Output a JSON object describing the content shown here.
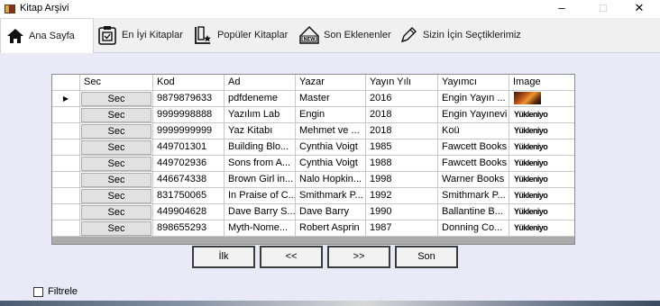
{
  "window": {
    "title": "Kitap Arşivi",
    "minimize": "–",
    "maximize": "□",
    "close": "✕"
  },
  "tabs": [
    {
      "label": "Ana Sayfa",
      "icon": "home-icon"
    },
    {
      "label": "En İyi Kitaplar",
      "icon": "checkbox-book-icon"
    },
    {
      "label": "Popüler Kitaplar",
      "icon": "popular-book-icon"
    },
    {
      "label": "Son Eklenenler",
      "icon": "new-badge-icon"
    },
    {
      "label": "Sizin İçin Seçtiklerimiz",
      "icon": "pen-icon"
    }
  ],
  "grid": {
    "columns": [
      "Sec",
      "Kod",
      "Ad",
      "Yazar",
      "Yayın Yılı",
      "Yayımcı",
      "Image"
    ],
    "rows": [
      {
        "sec": "Sec",
        "kod": "9879879633",
        "ad": "pdfdeneme",
        "yazar": "Master",
        "yil": "2016",
        "yayimci": "Engin Yayın ...",
        "image": "",
        "thumb": true,
        "current": true
      },
      {
        "sec": "Sec",
        "kod": "9999998888",
        "ad": "Yazılım Lab",
        "yazar": "Engin",
        "yil": "2018",
        "yayimci": "Engin Yayınevi",
        "image": "Yükleniyo"
      },
      {
        "sec": "Sec",
        "kod": "9999999999",
        "ad": "Yaz Kitabı",
        "yazar": "Mehmet ve ...",
        "yil": "2018",
        "yayimci": "Koü",
        "image": "Yükleniyo"
      },
      {
        "sec": "Sec",
        "kod": "449701301",
        "ad": "Building Blo...",
        "yazar": "Cynthia Voigt",
        "yil": "1985",
        "yayimci": "Fawcett Books",
        "image": "Yükleniyo"
      },
      {
        "sec": "Sec",
        "kod": "449702936",
        "ad": "Sons from A...",
        "yazar": "Cynthia Voigt",
        "yil": "1988",
        "yayimci": "Fawcett Books",
        "image": "Yükleniyo"
      },
      {
        "sec": "Sec",
        "kod": "446674338",
        "ad": "Brown Girl in...",
        "yazar": "Nalo Hopkin...",
        "yil": "1998",
        "yayimci": "Warner Books",
        "image": "Yükleniyo"
      },
      {
        "sec": "Sec",
        "kod": "831750065",
        "ad": "In Praise of C...",
        "yazar": "Smithmark P...",
        "yil": "1992",
        "yayimci": "Smithmark P...",
        "image": "Yükleniyo"
      },
      {
        "sec": "Sec",
        "kod": "449904628",
        "ad": "Dave Barry S...",
        "yazar": "Dave Barry",
        "yil": "1990",
        "yayimci": "Ballantine B...",
        "image": "Yükleniyo"
      },
      {
        "sec": "Sec",
        "kod": "898655293",
        "ad": "Myth-Nome...",
        "yazar": "Robert Asprin",
        "yil": "1987",
        "yayimci": "Donning Co...",
        "image": "Yükleniyo"
      }
    ]
  },
  "pagination": {
    "first": "İlk",
    "prev": "<<",
    "next": ">>",
    "last": "Son"
  },
  "filter": {
    "label": "Filtrele",
    "checked": false
  },
  "colors": {
    "panel": "#e9e9f7",
    "grid_bg": "#ababab",
    "button": "#e1e1e1"
  }
}
